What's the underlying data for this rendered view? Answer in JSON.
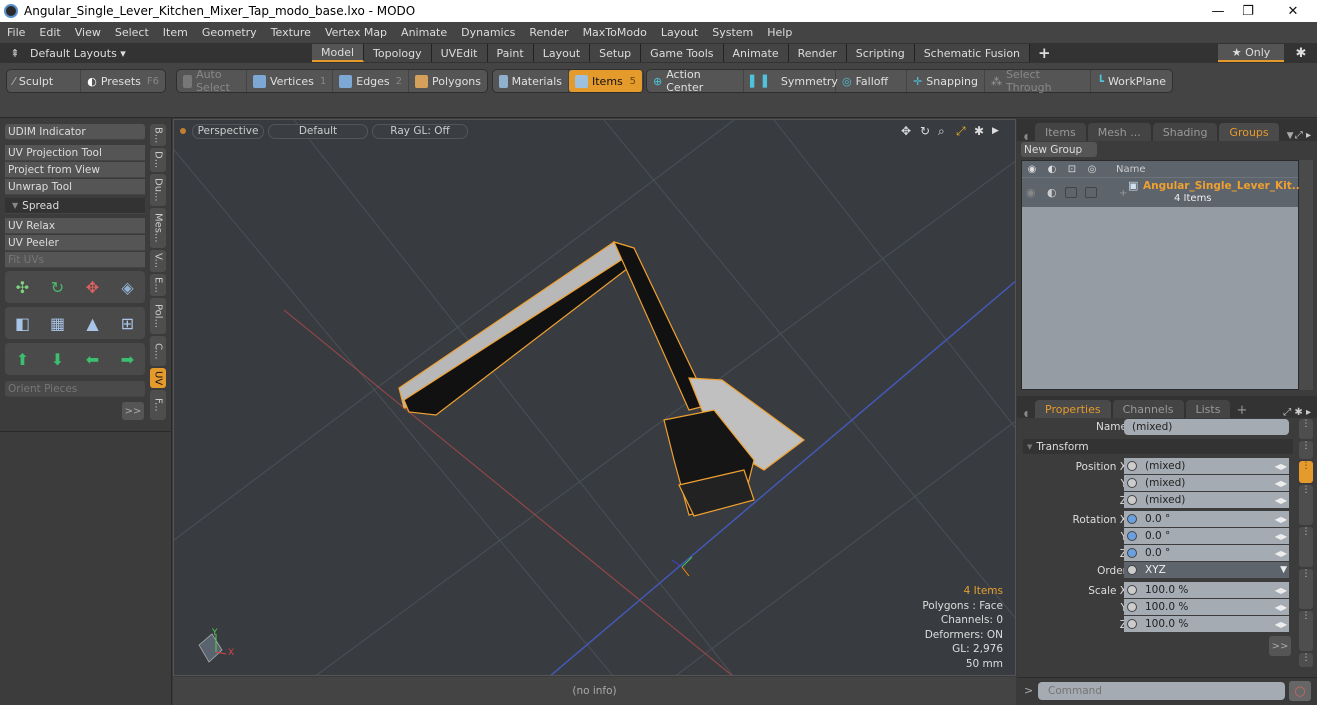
{
  "window": {
    "title": "Angular_Single_Lever_Kitchen_Mixer_Tap_modo_base.lxo - MODO",
    "minimize": "—",
    "restore": "❐",
    "close": "✕"
  },
  "menu": [
    "File",
    "Edit",
    "View",
    "Select",
    "Item",
    "Geometry",
    "Texture",
    "Vertex Map",
    "Animate",
    "Dynamics",
    "Render",
    "MaxToModo",
    "Layout",
    "System",
    "Help"
  ],
  "layouts": {
    "label": "Default Layouts ▾",
    "tabs": [
      "Model",
      "Topology",
      "UVEdit",
      "Paint",
      "Layout",
      "Setup",
      "Game Tools",
      "Animate",
      "Render",
      "Scripting",
      "Schematic Fusion"
    ],
    "active": "Model",
    "add": "+",
    "only": "★ Only",
    "gear": "✱"
  },
  "toolbar": {
    "sculpt": "Sculpt",
    "presets": "Presets",
    "presets_key": "F6",
    "auto_select": "Auto Select",
    "vertices": "Vertices",
    "vertices_key": "1",
    "edges": "Edges",
    "edges_key": "2",
    "polygons": "Polygons",
    "materials": "Materials",
    "items": "Items",
    "items_key": "5",
    "action_center": "Action Center",
    "symmetry": "Symmetry",
    "falloff": "Falloff",
    "snapping": "Snapping",
    "select_through": "Select Through",
    "workplane": "WorkPlane"
  },
  "left": {
    "buttons": [
      "UDIM Indicator",
      "UV Projection Tool",
      "Project from View",
      "Unwrap Tool"
    ],
    "spread": "Spread",
    "buttons2": [
      "UV Relax",
      "UV Peeler",
      "Fit UVs"
    ],
    "orient": "Orient Pieces",
    "more": ">>",
    "vtabs": [
      "B...",
      "D...",
      "Du...",
      "Mes...",
      "V...",
      "E...",
      "Pol...",
      "C...",
      "UV",
      "F..."
    ]
  },
  "viewport": {
    "perspective": "Perspective",
    "default": "Default",
    "raygl": "Ray GL: Off",
    "info": {
      "items": "4 Items",
      "polygons": "Polygons : Face",
      "channels": "Channels: 0",
      "deformers": "Deformers: ON",
      "gl": "GL: 2,976",
      "size": "50 mm"
    },
    "axis_y": "Y",
    "axis_x": "X"
  },
  "status": "(no info)",
  "groups": {
    "tabs": [
      "Items",
      "Mesh ...",
      "Shading",
      "Groups"
    ],
    "active": "Groups",
    "new_group": "New Group",
    "col_name": "Name",
    "row_name": "Angular_Single_Lever_Kit...",
    "row_count": "4 Items"
  },
  "properties": {
    "tabs": [
      "Properties",
      "Channels",
      "Lists"
    ],
    "add": "+",
    "name_label": "Name",
    "name_value": "(mixed)",
    "section": "Transform",
    "position": {
      "label": "Position X",
      "x": "(mixed)",
      "y": "(mixed)",
      "z": "(mixed)"
    },
    "rotation": {
      "label": "Rotation X",
      "x": "0.0 °",
      "y": "0.0 °",
      "z": "0.0 °"
    },
    "order": {
      "label": "Order",
      "value": "XYZ"
    },
    "scale": {
      "label": "Scale X",
      "x": "100.0 %",
      "y": "100.0 %",
      "z": "100.0 %"
    },
    "y": "Y",
    "z": "Z",
    "more": ">>"
  },
  "command": {
    "placeholder": "Command",
    "prompt": ">"
  }
}
